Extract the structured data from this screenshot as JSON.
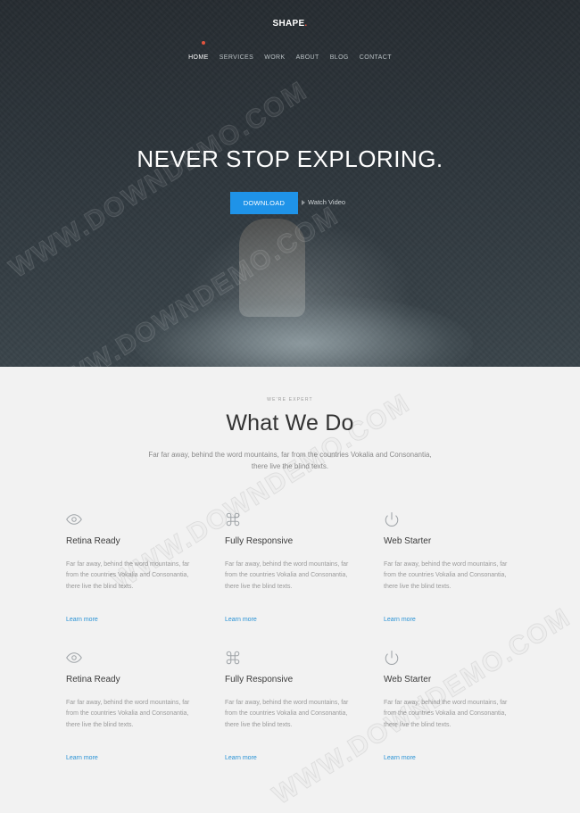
{
  "brand": {
    "name": "SHAPE",
    "dot": ".",
    "accent": "#e2543e"
  },
  "nav": [
    {
      "label": "HOME",
      "active": true
    },
    {
      "label": "SERVICES",
      "active": false
    },
    {
      "label": "WORK",
      "active": false
    },
    {
      "label": "ABOUT",
      "active": false
    },
    {
      "label": "BLOG",
      "active": false
    },
    {
      "label": "CONTACT",
      "active": false
    }
  ],
  "hero": {
    "title": "NEVER STOP EXPLORING.",
    "download_label": "DOWNLOAD",
    "watch_label": "Watch Video",
    "button_color": "#1f93e8"
  },
  "section": {
    "eyebrow": "WE'RE EXPERT",
    "title": "What We Do",
    "lead": "Far far away, behind the word mountains, far from the countries Vokalia and Consonantia, there live the blind texts."
  },
  "features": [
    {
      "icon": "eye-icon",
      "title": "Retina Ready",
      "text": "Far far away, behind the word mountains, far from the countries Vokalia and Consonantia, there live the blind texts.",
      "link": "Learn more"
    },
    {
      "icon": "command-icon",
      "title": "Fully Responsive",
      "text": "Far far away, behind the word mountains, far from the countries Vokalia and Consonantia, there live the blind texts.",
      "link": "Learn more"
    },
    {
      "icon": "power-icon",
      "title": "Web Starter",
      "text": "Far far away, behind the word mountains, far from the countries Vokalia and Consonantia, there live the blind texts.",
      "link": "Learn more"
    },
    {
      "icon": "eye-icon",
      "title": "Retina Ready",
      "text": "Far far away, behind the word mountains, far from the countries Vokalia and Consonantia, there live the blind texts.",
      "link": "Learn more"
    },
    {
      "icon": "command-icon",
      "title": "Fully Responsive",
      "text": "Far far away, behind the word mountains, far from the countries Vokalia and Consonantia, there live the blind texts.",
      "link": "Learn more"
    },
    {
      "icon": "power-icon",
      "title": "Web Starter",
      "text": "Far far away, behind the word mountains, far from the countries Vokalia and Consonantia, there live the blind texts.",
      "link": "Learn more"
    }
  ],
  "watermark": "WWW.DOWNDEMO.COM",
  "link_color": "#2a93d5"
}
